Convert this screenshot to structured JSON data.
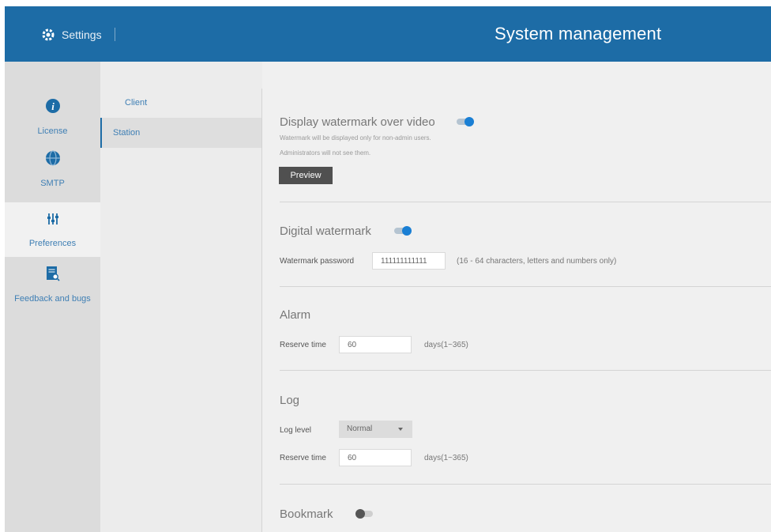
{
  "header": {
    "settings_label": "Settings",
    "title": "System management"
  },
  "nav": {
    "items": [
      {
        "label": "License",
        "icon": "info-icon"
      },
      {
        "label": "SMTP",
        "icon": "globe-icon"
      },
      {
        "label": "Preferences",
        "icon": "sliders-icon",
        "active": true
      },
      {
        "label": "Feedback and bugs",
        "icon": "report-icon"
      }
    ]
  },
  "subnav": {
    "items": [
      {
        "label": "Client"
      },
      {
        "label": "Station",
        "active": true
      }
    ]
  },
  "watermark_display": {
    "title": "Display watermark over video",
    "enabled": true,
    "note1": "Watermark will be displayed only for non-admin users.",
    "note2": "Administrators will not see them.",
    "preview_label": "Preview"
  },
  "digital_watermark": {
    "title": "Digital watermark",
    "enabled": true,
    "password_label": "Watermark password",
    "password_value": "111111111111",
    "password_hint": "(16 - 64 characters, letters and numbers only)"
  },
  "alarm": {
    "title": "Alarm",
    "reserve_label": "Reserve time",
    "reserve_value": "60",
    "reserve_unit": "days(1~365)"
  },
  "log": {
    "title": "Log",
    "level_label": "Log level",
    "level_value": "Normal",
    "reserve_label": "Reserve time",
    "reserve_value": "60",
    "reserve_unit": "days(1~365)"
  },
  "bookmark": {
    "title": "Bookmark",
    "enabled": false
  },
  "colors": {
    "header_bg": "#1d6ca6",
    "accent": "#1a7fd4",
    "nav_link": "#3f7fb4"
  }
}
